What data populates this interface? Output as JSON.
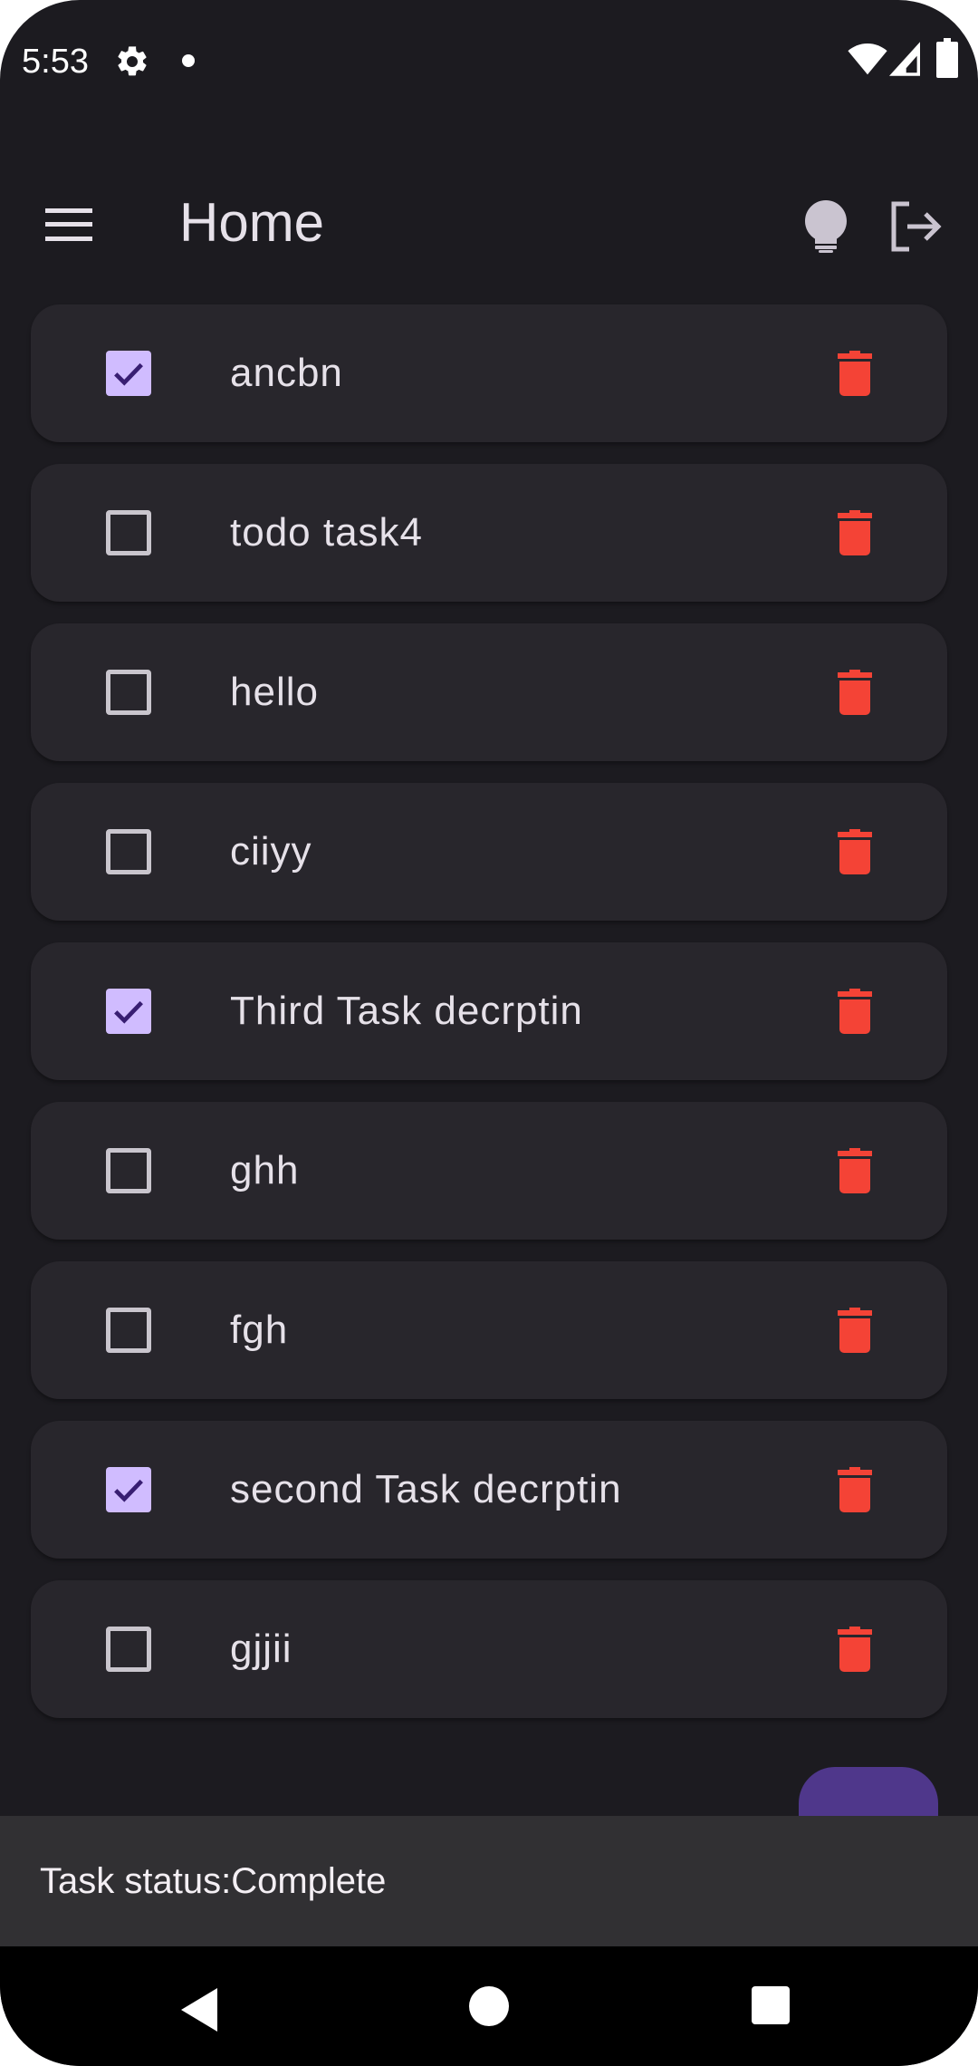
{
  "status_bar": {
    "time": "5:53",
    "icons": [
      "gear-icon",
      "notification-dot-icon",
      "wifi-icon",
      "signal-icon",
      "battery-icon"
    ]
  },
  "app_bar": {
    "title": "Home",
    "icons": [
      "menu-icon",
      "lightbulb-icon",
      "logout-icon"
    ]
  },
  "tasks": [
    {
      "label": "ancbn",
      "checked": true
    },
    {
      "label": "todo task4",
      "checked": false
    },
    {
      "label": "hello",
      "checked": false
    },
    {
      "label": "ciiyy",
      "checked": false
    },
    {
      "label": "Third Task decrptin",
      "checked": true
    },
    {
      "label": "ghh",
      "checked": false
    },
    {
      "label": "fgh",
      "checked": false
    },
    {
      "label": "second Task decrptin",
      "checked": true
    },
    {
      "label": "gjjii",
      "checked": false
    }
  ],
  "snackbar": {
    "message": "Task status:Complete"
  },
  "nav_bar": {
    "icons": [
      "back-icon",
      "home-icon",
      "recents-icon"
    ]
  },
  "colors": {
    "background": "#1c1b20",
    "card": "#28262c",
    "checkbox_checked": "#d0bcff",
    "checkmark": "#381e72",
    "delete": "#f44336",
    "fab": "#4f378b",
    "snackbar": "#313033"
  }
}
